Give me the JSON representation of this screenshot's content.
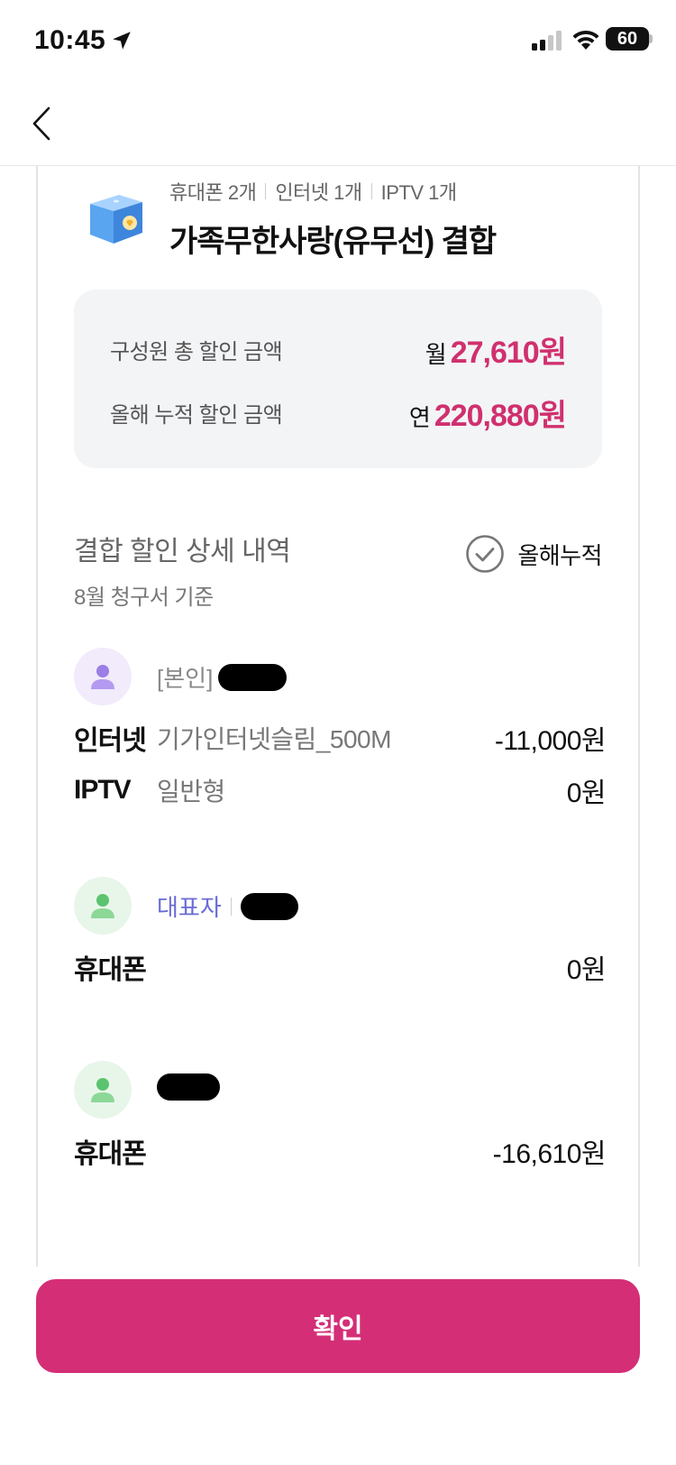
{
  "status_bar": {
    "time": "10:45",
    "battery": "60"
  },
  "plan": {
    "tags": [
      "휴대폰 2개",
      "인터넷 1개",
      "IPTV 1개"
    ],
    "title": "가족무한사랑(유무선) 결합"
  },
  "summary": {
    "monthly": {
      "label": "구성원 총 할인 금액",
      "prefix": "월",
      "amount": "27,610원"
    },
    "yearly": {
      "label": "올해 누적 할인 금액",
      "prefix": "연",
      "amount": "220,880원"
    },
    "accent_color": "#d0306f"
  },
  "detail": {
    "title": "결합 할인 상세 내역",
    "subtitle": "8월 청구서 기준",
    "toggle_label": "올해누적"
  },
  "members": [
    {
      "role": "[본인]",
      "avatar_color": "purple",
      "lines": [
        {
          "category": "인터넷",
          "name": "기가인터넷슬림_500M",
          "amount": "-11,000원"
        },
        {
          "category": "IPTV",
          "name": "일반형",
          "amount": "0원"
        }
      ]
    },
    {
      "role": "대표자",
      "avatar_color": "green",
      "lines": [
        {
          "category": "휴대폰",
          "name": "",
          "amount": "0원"
        }
      ]
    },
    {
      "role": "",
      "avatar_color": "green",
      "lines": [
        {
          "category": "휴대폰",
          "name": "",
          "amount": "-16,610원"
        }
      ]
    }
  ],
  "confirm_label": "확인",
  "button_color": "#d42e77"
}
